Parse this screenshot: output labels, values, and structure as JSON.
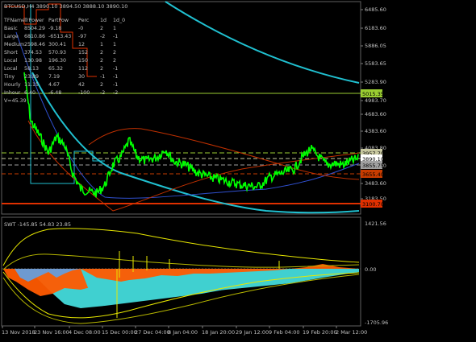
{
  "symbol_header": "BTCUSD,H4  3890.10 3894.50 3888.10 3890.10",
  "table": {
    "headers": [
      "TFName",
      "TrPower",
      "PartPow",
      "Perc",
      "1d",
      "1d_0"
    ],
    "rows": [
      [
        "Basic",
        "8504.29",
        "-9.18",
        "-0",
        "2",
        "1"
      ],
      [
        "Large",
        "6810.86",
        "-6513.43",
        "-97",
        "-2",
        "-1"
      ],
      [
        "Medium",
        "2598.46",
        "300.41",
        "12",
        "1",
        "1"
      ],
      [
        "Short",
        "374.53",
        "570.93",
        "152",
        "2",
        "2"
      ],
      [
        "Local",
        "130.98",
        "196.30",
        "150",
        "2",
        "2"
      ],
      [
        "Local",
        "58.13",
        "65.32",
        "112",
        "2",
        "-1"
      ],
      [
        "Tiny",
        "23.89",
        "7.19",
        "30",
        "-1",
        "-1"
      ],
      [
        "Hourly",
        "11.15",
        "4.67",
        "42",
        "2",
        "-1"
      ],
      [
        "Inhour",
        "6.40",
        "-6.48",
        "-100",
        "-2",
        "-2"
      ]
    ],
    "footer": "V=45.39"
  },
  "price_axis": {
    "ticks": [
      "6485.60",
      "6183.60",
      "5886.05",
      "5583.65",
      "5283.90",
      "4983.70",
      "4683.60",
      "4383.60",
      "4083.80",
      "3783.80",
      "3483.60",
      "3183.50"
    ]
  },
  "price_tags": [
    {
      "label": "5015.35",
      "color": "#9acd32"
    },
    {
      "label": "3957.70",
      "color": "#c8c8a0"
    },
    {
      "label": "3890.10",
      "color": "#ffffff"
    },
    {
      "label": "3855.75",
      "color": "#a0a0a0"
    },
    {
      "label": "3655.40",
      "color": "#c83c00"
    },
    {
      "label": "3100.70",
      "color": "#e03000"
    }
  ],
  "indicator": {
    "label": "SWT -145.85 54.83 23.85",
    "axis": [
      "1421.56",
      "0.00",
      "-1705.96"
    ]
  },
  "time_axis": [
    "13 Nov 2018",
    "23 Nov 16:00",
    "4 Dec 08:00",
    "15 Dec 00:00",
    "27 Dec 04:00",
    "8 Jan 04:00",
    "18 Jan 20:00",
    "29 Jan 12:00",
    "9 Feb 04:00",
    "19 Feb 20:00",
    "2 Mar 12:00"
  ],
  "colors": {
    "bg": "#000000",
    "candles": "#00ff00",
    "cyan": "#20c0d0",
    "orange": "#ff5a00",
    "yellow": "#e8e800",
    "red": "#e03000",
    "text": "#c0c0c0"
  }
}
